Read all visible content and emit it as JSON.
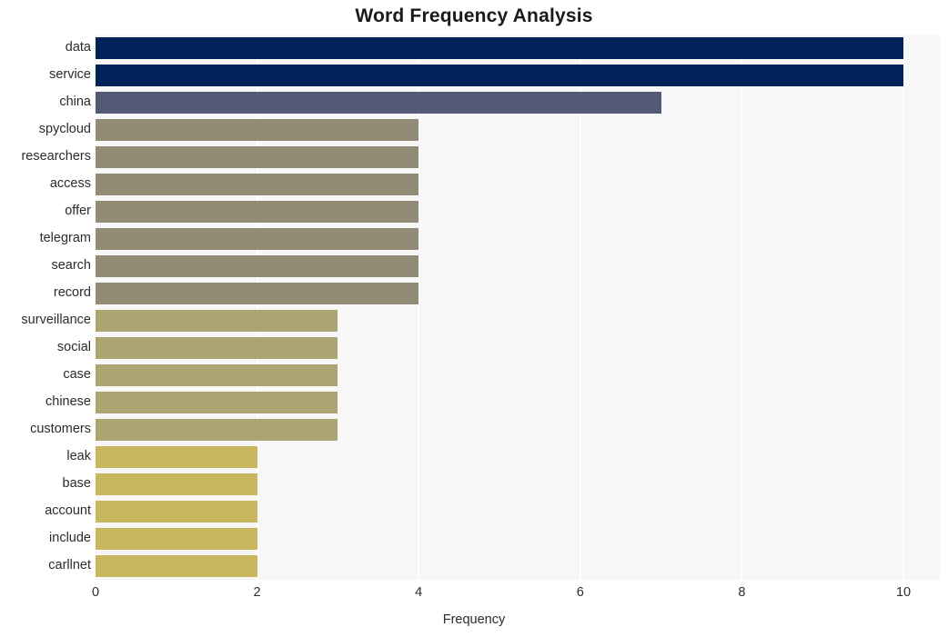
{
  "chart_data": {
    "type": "bar",
    "orientation": "horizontal",
    "title": "Word Frequency Analysis",
    "xlabel": "Frequency",
    "ylabel": "",
    "categories": [
      "data",
      "service",
      "china",
      "spycloud",
      "researchers",
      "access",
      "offer",
      "telegram",
      "search",
      "record",
      "surveillance",
      "social",
      "case",
      "chinese",
      "customers",
      "leak",
      "base",
      "account",
      "include",
      "carllnet"
    ],
    "values": [
      10,
      10,
      7,
      4,
      4,
      4,
      4,
      4,
      4,
      4,
      3,
      3,
      3,
      3,
      3,
      2,
      2,
      2,
      2,
      2
    ],
    "bar_colors": [
      "#00245a",
      "#00245a",
      "#525a75",
      "#928c76",
      "#928c76",
      "#928c76",
      "#928c76",
      "#928c76",
      "#928c76",
      "#928c76",
      "#ada571",
      "#ada571",
      "#ada571",
      "#ada571",
      "#ada571",
      "#c8b75f",
      "#c8b75f",
      "#c8b75f",
      "#c8b75f",
      "#c8b75f"
    ],
    "xlim": [
      0,
      10.45
    ],
    "xticks": [
      0,
      2,
      4,
      6,
      8,
      10
    ],
    "xtick_labels": [
      "0",
      "2",
      "4",
      "6",
      "8",
      "10"
    ],
    "grid": "vertical-white",
    "plot_background": "#f7f7f7",
    "figure_background": "#ffffff",
    "legend": null,
    "colormap": "cividis"
  }
}
